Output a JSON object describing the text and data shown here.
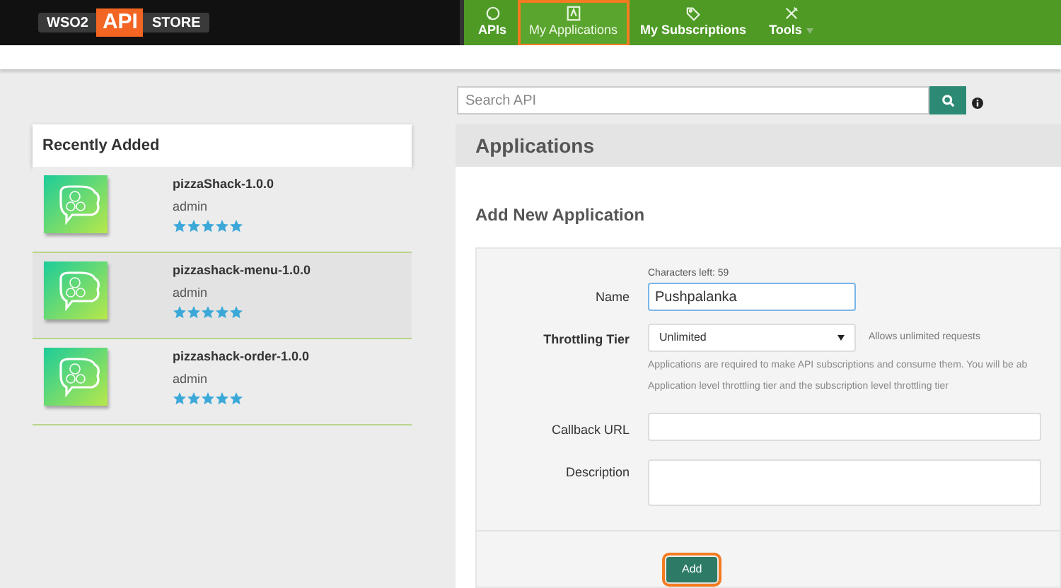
{
  "logo": {
    "left": "WSO2",
    "middle": "API",
    "right": "STORE"
  },
  "nav": [
    {
      "label": "APIs",
      "selected": false,
      "highlighted": false,
      "kind": "chat",
      "dropdown": false
    },
    {
      "label": "My Applications",
      "selected": true,
      "highlighted": true,
      "kind": "app",
      "dropdown": false
    },
    {
      "label": "My Subscriptions",
      "selected": false,
      "highlighted": false,
      "kind": "tag",
      "dropdown": false
    },
    {
      "label": "Tools",
      "selected": false,
      "highlighted": false,
      "kind": "tools",
      "dropdown": true
    }
  ],
  "search": {
    "placeholder": "Search API"
  },
  "recently_added": {
    "title": "Recently Added",
    "items": [
      {
        "name": "pizzaShack-1.0.0",
        "provider": "admin",
        "stars": 5
      },
      {
        "name": "pizzashack-menu-1.0.0",
        "provider": "admin",
        "stars": 5
      },
      {
        "name": "pizzashack-order-1.0.0",
        "provider": "admin",
        "stars": 5
      }
    ]
  },
  "applications": {
    "title": "Applications",
    "form_title": "Add New Application",
    "characters_left": "Characters left: 59",
    "name": {
      "label": "Name",
      "value": "Pushpalanka"
    },
    "tier": {
      "label": "Throttling Tier",
      "value": "Unlimited",
      "hint": "Allows unlimited requests",
      "help": [
        "Applications are required to make API subscriptions and consume them. You will be ab",
        "Application level throttling tier and the subscription level throttling tier"
      ]
    },
    "callback": {
      "label": "Callback URL"
    },
    "description": {
      "label": "Description"
    },
    "add_button": {
      "label": "Add",
      "highlighted": true
    }
  }
}
